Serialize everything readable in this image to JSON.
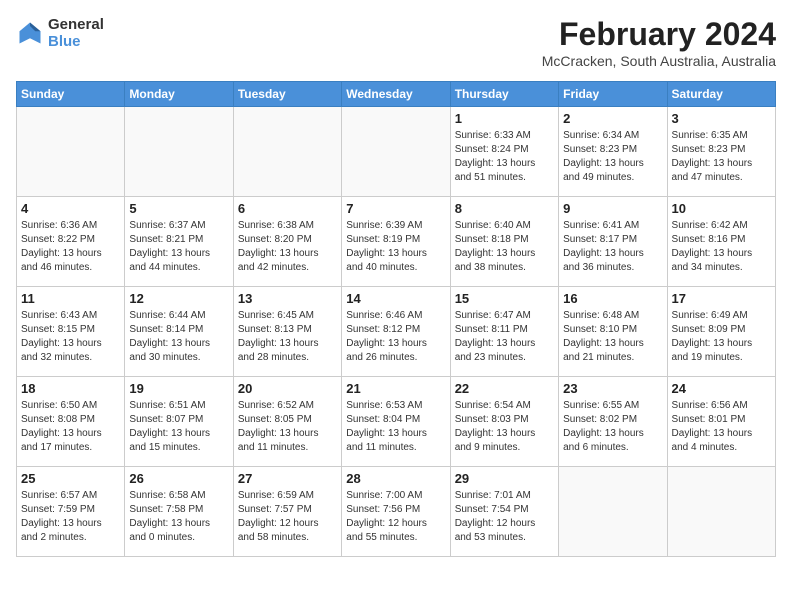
{
  "header": {
    "logo_general": "General",
    "logo_blue": "Blue",
    "month_year": "February 2024",
    "location": "McCracken, South Australia, Australia"
  },
  "weekdays": [
    "Sunday",
    "Monday",
    "Tuesday",
    "Wednesday",
    "Thursday",
    "Friday",
    "Saturday"
  ],
  "weeks": [
    [
      {
        "day": "",
        "detail": ""
      },
      {
        "day": "",
        "detail": ""
      },
      {
        "day": "",
        "detail": ""
      },
      {
        "day": "",
        "detail": ""
      },
      {
        "day": "1",
        "detail": "Sunrise: 6:33 AM\nSunset: 8:24 PM\nDaylight: 13 hours\nand 51 minutes."
      },
      {
        "day": "2",
        "detail": "Sunrise: 6:34 AM\nSunset: 8:23 PM\nDaylight: 13 hours\nand 49 minutes."
      },
      {
        "day": "3",
        "detail": "Sunrise: 6:35 AM\nSunset: 8:23 PM\nDaylight: 13 hours\nand 47 minutes."
      }
    ],
    [
      {
        "day": "4",
        "detail": "Sunrise: 6:36 AM\nSunset: 8:22 PM\nDaylight: 13 hours\nand 46 minutes."
      },
      {
        "day": "5",
        "detail": "Sunrise: 6:37 AM\nSunset: 8:21 PM\nDaylight: 13 hours\nand 44 minutes."
      },
      {
        "day": "6",
        "detail": "Sunrise: 6:38 AM\nSunset: 8:20 PM\nDaylight: 13 hours\nand 42 minutes."
      },
      {
        "day": "7",
        "detail": "Sunrise: 6:39 AM\nSunset: 8:19 PM\nDaylight: 13 hours\nand 40 minutes."
      },
      {
        "day": "8",
        "detail": "Sunrise: 6:40 AM\nSunset: 8:18 PM\nDaylight: 13 hours\nand 38 minutes."
      },
      {
        "day": "9",
        "detail": "Sunrise: 6:41 AM\nSunset: 8:17 PM\nDaylight: 13 hours\nand 36 minutes."
      },
      {
        "day": "10",
        "detail": "Sunrise: 6:42 AM\nSunset: 8:16 PM\nDaylight: 13 hours\nand 34 minutes."
      }
    ],
    [
      {
        "day": "11",
        "detail": "Sunrise: 6:43 AM\nSunset: 8:15 PM\nDaylight: 13 hours\nand 32 minutes."
      },
      {
        "day": "12",
        "detail": "Sunrise: 6:44 AM\nSunset: 8:14 PM\nDaylight: 13 hours\nand 30 minutes."
      },
      {
        "day": "13",
        "detail": "Sunrise: 6:45 AM\nSunset: 8:13 PM\nDaylight: 13 hours\nand 28 minutes."
      },
      {
        "day": "14",
        "detail": "Sunrise: 6:46 AM\nSunset: 8:12 PM\nDaylight: 13 hours\nand 26 minutes."
      },
      {
        "day": "15",
        "detail": "Sunrise: 6:47 AM\nSunset: 8:11 PM\nDaylight: 13 hours\nand 23 minutes."
      },
      {
        "day": "16",
        "detail": "Sunrise: 6:48 AM\nSunset: 8:10 PM\nDaylight: 13 hours\nand 21 minutes."
      },
      {
        "day": "17",
        "detail": "Sunrise: 6:49 AM\nSunset: 8:09 PM\nDaylight: 13 hours\nand 19 minutes."
      }
    ],
    [
      {
        "day": "18",
        "detail": "Sunrise: 6:50 AM\nSunset: 8:08 PM\nDaylight: 13 hours\nand 17 minutes."
      },
      {
        "day": "19",
        "detail": "Sunrise: 6:51 AM\nSunset: 8:07 PM\nDaylight: 13 hours\nand 15 minutes."
      },
      {
        "day": "20",
        "detail": "Sunrise: 6:52 AM\nSunset: 8:05 PM\nDaylight: 13 hours\nand 11 minutes."
      },
      {
        "day": "21",
        "detail": "Sunrise: 6:53 AM\nSunset: 8:04 PM\nDaylight: 13 hours\nand 11 minutes."
      },
      {
        "day": "22",
        "detail": "Sunrise: 6:54 AM\nSunset: 8:03 PM\nDaylight: 13 hours\nand 9 minutes."
      },
      {
        "day": "23",
        "detail": "Sunrise: 6:55 AM\nSunset: 8:02 PM\nDaylight: 13 hours\nand 6 minutes."
      },
      {
        "day": "24",
        "detail": "Sunrise: 6:56 AM\nSunset: 8:01 PM\nDaylight: 13 hours\nand 4 minutes."
      }
    ],
    [
      {
        "day": "25",
        "detail": "Sunrise: 6:57 AM\nSunset: 7:59 PM\nDaylight: 13 hours\nand 2 minutes."
      },
      {
        "day": "26",
        "detail": "Sunrise: 6:58 AM\nSunset: 7:58 PM\nDaylight: 13 hours\nand 0 minutes."
      },
      {
        "day": "27",
        "detail": "Sunrise: 6:59 AM\nSunset: 7:57 PM\nDaylight: 12 hours\nand 58 minutes."
      },
      {
        "day": "28",
        "detail": "Sunrise: 7:00 AM\nSunset: 7:56 PM\nDaylight: 12 hours\nand 55 minutes."
      },
      {
        "day": "29",
        "detail": "Sunrise: 7:01 AM\nSunset: 7:54 PM\nDaylight: 12 hours\nand 53 minutes."
      },
      {
        "day": "",
        "detail": ""
      },
      {
        "day": "",
        "detail": ""
      }
    ]
  ]
}
